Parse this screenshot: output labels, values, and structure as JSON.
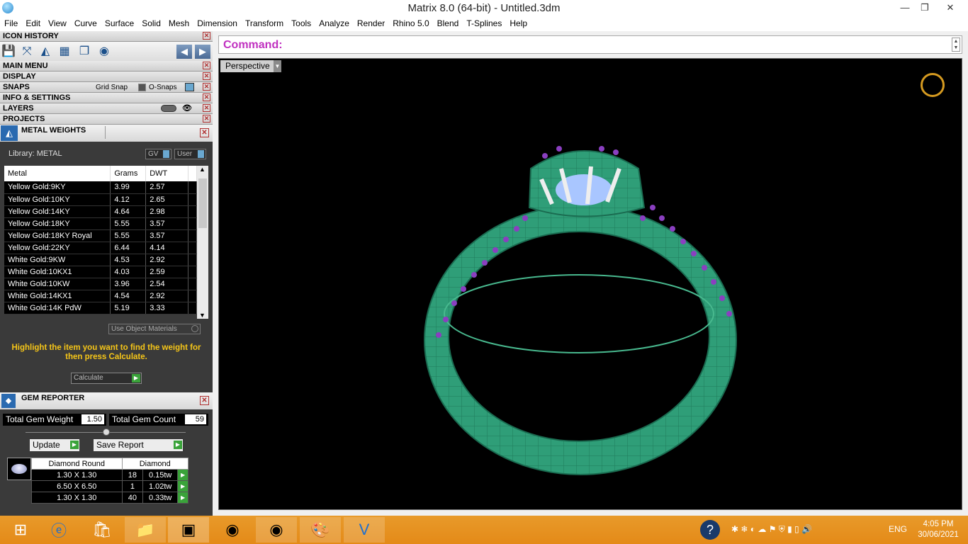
{
  "window": {
    "title": "Matrix 8.0 (64-bit) - Untitled.3dm",
    "minimize": "—",
    "restore": "❐",
    "close": "✕"
  },
  "menu": [
    "File",
    "Edit",
    "View",
    "Curve",
    "Surface",
    "Solid",
    "Mesh",
    "Dimension",
    "Transform",
    "Tools",
    "Analyze",
    "Render",
    "Rhino 5.0",
    "Blend",
    "T-Splines",
    "Help"
  ],
  "panels": {
    "icon_history": "ICON HISTORY",
    "main_menu": "MAIN MENU",
    "display": "DISPLAY",
    "snaps": "SNAPS",
    "grid_snap": "Grid Snap",
    "o_snaps": "O-Snaps",
    "info_settings": "INFO & SETTINGS",
    "layers": "LAYERS",
    "projects": "PROJECTS"
  },
  "metal_weights": {
    "title": "METAL WEIGHTS",
    "library": "Library: METAL",
    "gv": "GV",
    "user": "User",
    "columns": [
      "Metal",
      "Grams",
      "DWT"
    ],
    "rows": [
      [
        "Yellow Gold:9KY",
        "3.99",
        "2.57"
      ],
      [
        "Yellow Gold:10KY",
        "4.12",
        "2.65"
      ],
      [
        "Yellow Gold:14KY",
        "4.64",
        "2.98"
      ],
      [
        "Yellow Gold:18KY",
        "5.55",
        "3.57"
      ],
      [
        "Yellow Gold:18KY Royal",
        "5.55",
        "3.57"
      ],
      [
        "Yellow Gold:22KY",
        "6.44",
        "4.14"
      ],
      [
        "White Gold:9KW",
        "4.53",
        "2.92"
      ],
      [
        "White Gold:10KX1",
        "4.03",
        "2.59"
      ],
      [
        "White Gold:10KW",
        "3.96",
        "2.54"
      ],
      [
        "White Gold:14KX1",
        "4.54",
        "2.92"
      ],
      [
        "White Gold:14K PdW",
        "5.19",
        "3.33"
      ]
    ],
    "use_object_materials": "Use Object Materials",
    "hint": "Highlight the item you want to find the weight for then press Calculate.",
    "calculate": "Calculate"
  },
  "gem_reporter": {
    "title": "GEM REPORTER",
    "total_weight_label": "Total Gem Weight",
    "total_weight": "1.50",
    "total_count_label": "Total Gem Count",
    "total_count": "59",
    "update": "Update",
    "save_report": "Save Report",
    "col_shape": "Diamond Round",
    "col_material": "Diamond",
    "rows": [
      [
        "1.30 X 1.30",
        "18",
        "0.15tw"
      ],
      [
        "6.50 X 6.50",
        "1",
        "1.02tw"
      ],
      [
        "1.30 X 1.30",
        "40",
        "0.33tw"
      ]
    ]
  },
  "command": {
    "label": "Command:"
  },
  "viewport": {
    "label": "Perspective"
  },
  "taskbar": {
    "lang": "ENG",
    "time": "4:05 PM",
    "date": "30/06/2021"
  },
  "colors": {
    "ring_green": "#2f9e78",
    "gem_purple": "#8a3fc0",
    "hint_yellow": "#f5c518",
    "taskbar": "#e48a18"
  }
}
